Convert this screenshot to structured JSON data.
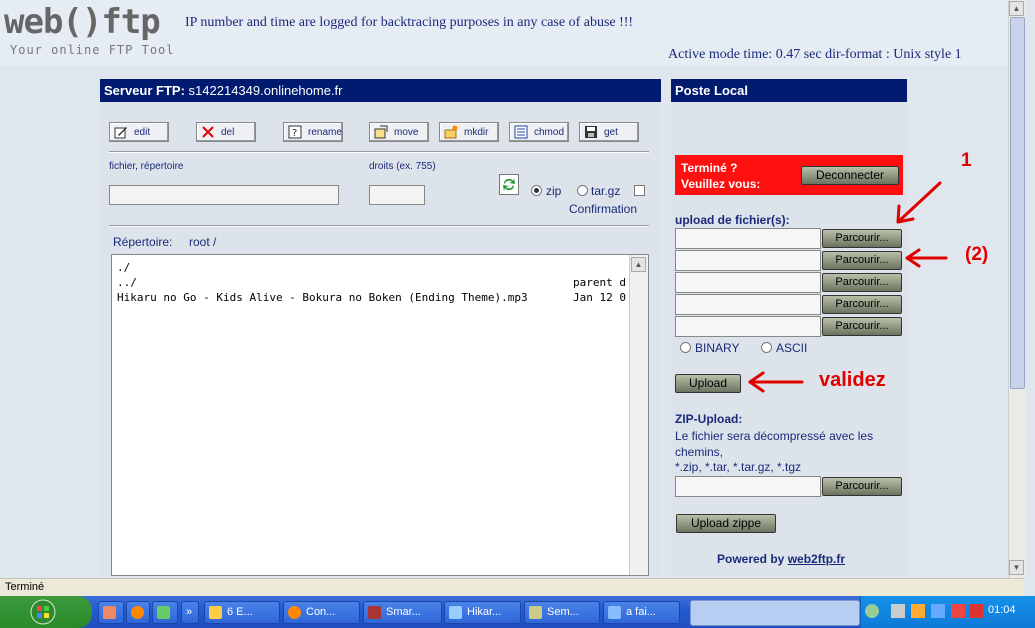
{
  "header": {
    "logo_text": "web()ftp",
    "logo_tagline": "Your online FTP Tool",
    "notice": "IP number and time are logged for backtracing purposes in any case of abuse !!!",
    "mode_info": "Active mode  time: 0.47 sec  dir-format :  Unix style 1"
  },
  "ftp_panel": {
    "title_label": "Serveur FTP:",
    "server": "s142214349.onlinehome.fr",
    "toolbar": [
      {
        "label": "edit",
        "icon": "edit-icon"
      },
      {
        "label": "del",
        "icon": "delete-icon"
      },
      {
        "label": "rename",
        "icon": "rename-icon"
      },
      {
        "label": "move",
        "icon": "move-icon"
      },
      {
        "label": "mkdir",
        "icon": "mkdir-icon"
      },
      {
        "label": "chmod",
        "icon": "chmod-icon"
      },
      {
        "label": "get",
        "icon": "save-icon"
      }
    ],
    "file_label": "fichier, répertoire",
    "file_value": "",
    "rights_label": "droits (ex. 755)",
    "rights_value": "",
    "zip_label": "zip",
    "targz_label": "tar.gz",
    "confirm_label": "Confirmation",
    "directory_label": "Répertoire:",
    "directory_path": "root  /",
    "listing": [
      {
        "name": "./",
        "info": ""
      },
      {
        "name": "../",
        "info": "parent d"
      },
      {
        "name": "Hikaru no Go - Kids Alive - Bokura no Boken (Ending Theme).mp3",
        "info": "Jan 12 0"
      }
    ]
  },
  "local_panel": {
    "title": "Poste Local",
    "done_line1": "Terminé ?",
    "done_line2": "Veuillez vous:",
    "disconnect_label": "Deconnecter",
    "upload_label": "upload de fichier(s):",
    "browse_label": "Parcourir...",
    "binary_label": "BINARY",
    "ascii_label": "ASCII",
    "upload_button": "Upload",
    "zip_title": "ZIP-Upload:",
    "zip_desc": "Le fichier sera décompressé avec les chemins,",
    "zip_ext": "*.zip, *.tar, *.tar.gz, *.tgz",
    "upload_zip_button": "Upload zippe",
    "powered_prefix": "Powered by",
    "powered_link": "web2ftp.fr"
  },
  "annotations": {
    "num1": "1",
    "num2": "(2)",
    "validez": "validez"
  },
  "statusbar": {
    "text": "Terminé"
  },
  "taskbar": {
    "tasks": [
      "6 E...",
      "Con...",
      "Smar...",
      "Hikar...",
      "Sem...",
      "a fai..."
    ],
    "clock": "01:04"
  },
  "colors": {
    "title_bg": "#001a70",
    "panel_bg": "#dde3ea",
    "alert_red": "#ff1010",
    "annotation_red": "#e00000"
  }
}
